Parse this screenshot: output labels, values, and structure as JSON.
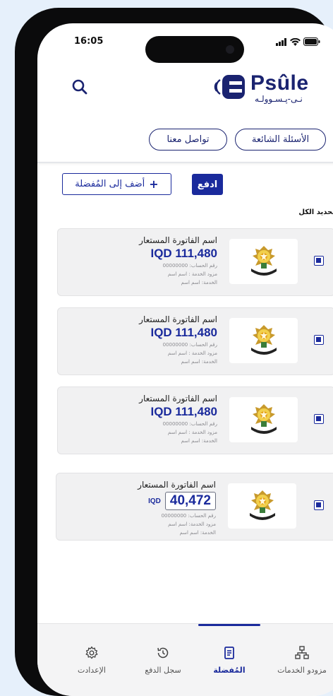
{
  "status_bar": {
    "time": "16:05"
  },
  "header": {
    "search_icon": "search-icon",
    "logo": {
      "word": "Psûle",
      "sub": "نـى-پـسـوولـه"
    }
  },
  "top_links": {
    "faq": "الأسئلة الشائعة",
    "contact": "تواصل معنا"
  },
  "actions": {
    "pay": "ادفع",
    "add_favorite": "أضف إلى المُفضلة",
    "add_symbol": "+"
  },
  "select_all": "تحديد الكل",
  "bills": [
    {
      "name": "اسم الفاتورة المستعار",
      "amount": "IQD 111,480",
      "account": "رقم الحساب: 00000000",
      "provider": "مزود الخدمة : اسم اسم",
      "service": "الخدمة: اسم اسم"
    },
    {
      "name": "اسم الفاتورة المستعار",
      "amount": "IQD 111,480",
      "account": "رقم الحساب: 00000000",
      "provider": "مزود الخدمة : اسم اسم",
      "service": "الخدمة: اسم اسم"
    },
    {
      "name": "اسم الفاتورة المستعار",
      "amount": "IQD 111,480",
      "account": "رقم الحساب: 00000000",
      "provider": "مزود الخدمة : اسم اسم",
      "service": "الخدمة: اسم اسم"
    }
  ],
  "editable_bill": {
    "name": "اسم الفاتورة المستعار",
    "currency": "IQD",
    "amount": "40,472",
    "account": "رقم الحساب: 00000000",
    "provider": "مزود الخدمة: اسم اسم",
    "service": "الخدمة: اسم اسم"
  },
  "bottom_nav": {
    "providers": "مزودو الخدمات",
    "favorites": "المُفضلة",
    "history": "سجل الدفع",
    "settings": "الإعدادت",
    "active": "favorites"
  },
  "colors": {
    "brand": "#1a2a9c",
    "brand_dark": "#1a2370"
  }
}
